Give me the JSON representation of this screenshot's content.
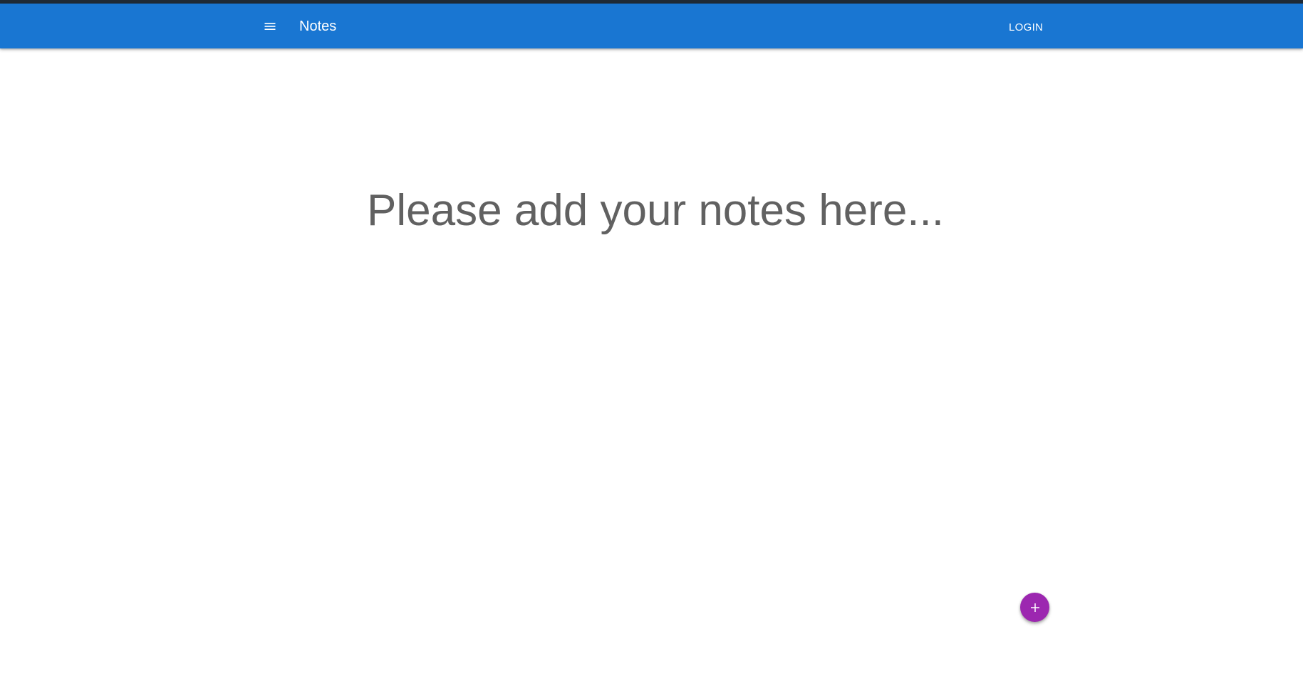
{
  "header": {
    "menu_icon": "hamburger-menu-icon",
    "title": "Notes",
    "login_label": "LOGIN",
    "background_color": "#1976d2"
  },
  "main": {
    "empty_message": "Please add your notes here..."
  },
  "fab": {
    "icon": "plus-icon",
    "color": "#9c27b0"
  }
}
